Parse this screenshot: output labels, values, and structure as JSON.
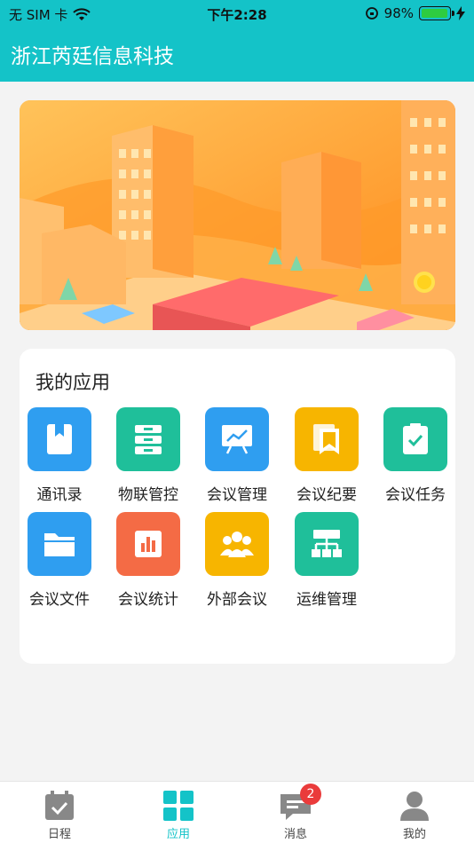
{
  "status_bar": {
    "carrier": "无 SIM 卡",
    "time": "下午2:28",
    "battery": "98%",
    "battery_level": 0.98
  },
  "header": {
    "title": "浙江芮廷信息科技"
  },
  "apps": {
    "title": "我的应用",
    "items": [
      {
        "label": "通讯录",
        "color": "#2f9ef0",
        "icon": "address-book-icon"
      },
      {
        "label": "物联管控",
        "color": "#1fbf9a",
        "icon": "server-icon"
      },
      {
        "label": "会议管理",
        "color": "#2f9ef0",
        "icon": "presentation-chart-icon"
      },
      {
        "label": "会议纪要",
        "color": "#f7b500",
        "icon": "bookmark-icon"
      },
      {
        "label": "会议任务",
        "color": "#1fbf9a",
        "icon": "clipboard-check-icon"
      },
      {
        "label": "会议文件",
        "color": "#2f9ef0",
        "icon": "folder-icon"
      },
      {
        "label": "会议统计",
        "color": "#f46b45",
        "icon": "bar-chart-icon"
      },
      {
        "label": "外部会议",
        "color": "#f7b500",
        "icon": "users-icon"
      },
      {
        "label": "运维管理",
        "color": "#1fbf9a",
        "icon": "network-icon"
      }
    ]
  },
  "tabs": [
    {
      "label": "日程",
      "icon": "calendar-check-icon"
    },
    {
      "label": "应用",
      "icon": "grid-icon"
    },
    {
      "label": "消息",
      "icon": "message-icon",
      "badge": "2"
    },
    {
      "label": "我的",
      "icon": "user-icon"
    }
  ]
}
